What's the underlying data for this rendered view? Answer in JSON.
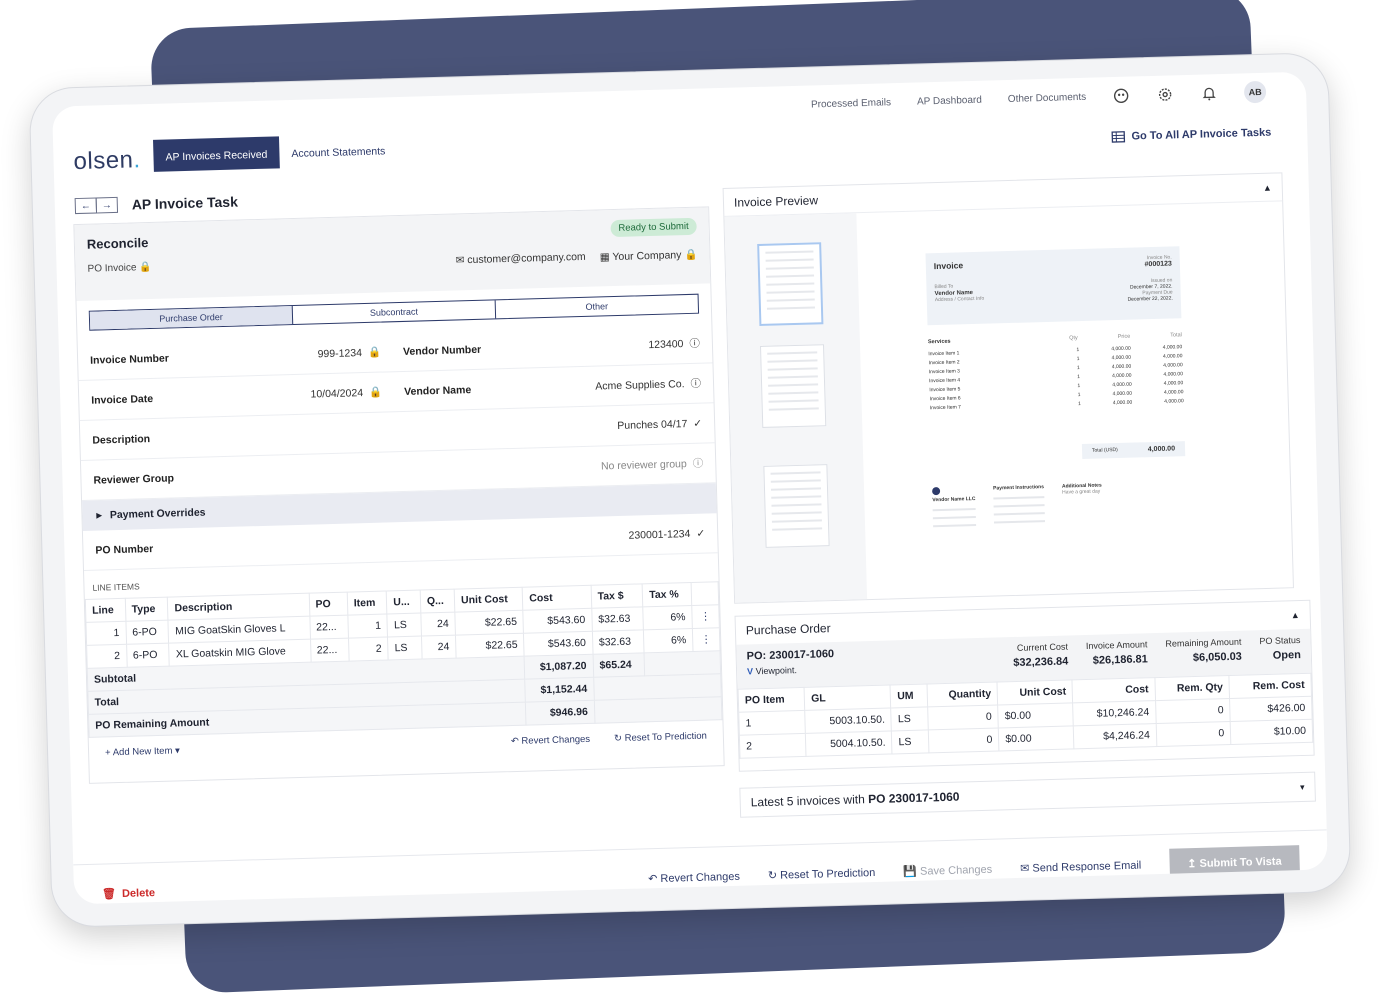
{
  "brand": {
    "logo_main": "olsen",
    "logo_dot": "."
  },
  "top_nav": {
    "items": [
      "Processed Emails",
      "AP Dashboard",
      "Other Documents"
    ],
    "avatar": "AB"
  },
  "main_tabs": [
    {
      "label": "AP Invoices Received"
    },
    {
      "label": "Account Statements"
    }
  ],
  "go_all": "Go To All AP Invoice Tasks",
  "page_title": "AP Invoice Task",
  "reconcile": {
    "title": "Reconcile",
    "subtitle": "PO Invoice",
    "status": "Ready to Submit",
    "email": "customer@company.com",
    "company": "Your Company",
    "segments": [
      "Purchase Order",
      "Subcontract",
      "Other"
    ]
  },
  "fields": {
    "invoice_number_label": "Invoice Number",
    "invoice_number": "999-1234",
    "vendor_number_label": "Vendor Number",
    "vendor_number": "123400",
    "invoice_date_label": "Invoice Date",
    "invoice_date": "10/04/2024",
    "vendor_name_label": "Vendor Name",
    "vendor_name": "Acme Supplies Co.",
    "description_label": "Description",
    "description": "Punches 04/17",
    "reviewer_group_label": "Reviewer Group",
    "reviewer_group": "No reviewer group",
    "payment_overrides": "Payment Overrides",
    "po_number_label": "PO Number",
    "po_number": "230001-1234"
  },
  "line_items": {
    "section_label": "LINE ITEMS",
    "headers": [
      "Line",
      "Type",
      "Description",
      "PO",
      "Item",
      "U...",
      "Q...",
      "Unit Cost",
      "Cost",
      "Tax $",
      "Tax %"
    ],
    "rows": [
      [
        "1",
        "6-PO",
        "MIG GoatSkin Gloves L",
        "22...",
        "1",
        "LS",
        "24",
        "$22.65",
        "$543.60",
        "$32.63",
        "6%"
      ],
      [
        "2",
        "6-PO",
        "XL Goatskin MIG Glove",
        "22...",
        "2",
        "LS",
        "24",
        "$22.65",
        "$543.60",
        "$32.63",
        "6%"
      ]
    ],
    "subtotal_label": "Subtotal",
    "subtotal_cost": "$1,087.20",
    "subtotal_tax": "$65.24",
    "total_label": "Total",
    "total": "$1,152.44",
    "remaining_label": "PO Remaining Amount",
    "remaining": "$946.96",
    "add_new": "Add New Item",
    "revert": "Revert Changes",
    "reset": "Reset To Prediction"
  },
  "preview": {
    "title": "Invoice Preview",
    "doc": {
      "heading": "Invoice",
      "invoice_no_label": "Invoice No.",
      "invoice_no": "#000123",
      "billed_to": "Billed To",
      "vendor": "Vendor Name",
      "address": "Address / Contact Info",
      "issued_label": "Issued on",
      "issued": "December 7, 2022.",
      "due_label": "Payment Due",
      "due": "December 22, 2022.",
      "services": "Services",
      "qty": "Qty",
      "price": "Price",
      "total_col": "Total",
      "items": [
        "Invoice Item 1",
        "Invoice Item 2",
        "Invoice Item 3",
        "Invoice Item 4",
        "Invoice Item 5",
        "Invoice Item 6",
        "Invoice Item 7"
      ],
      "item_qty": "1",
      "item_price": "4,000.00",
      "item_total": "4,000.00",
      "total_label": "Total (USD)",
      "total": "4,000.00",
      "vendor_llc": "Vendor Name LLC",
      "payment_instructions": "Payment Instructions",
      "additional_notes": "Additional Notes",
      "notes_text": "Have a great day"
    }
  },
  "purchase_order": {
    "title": "Purchase Order",
    "po": "PO: 230017-1060",
    "source": "Viewpoint.",
    "stats": [
      {
        "k": "Current Cost",
        "v": "$32,236.84"
      },
      {
        "k": "Invoice Amount",
        "v": "$26,186.81"
      },
      {
        "k": "Remaining Amount",
        "v": "$6,050.03"
      },
      {
        "k": "PO Status",
        "v": "Open"
      }
    ],
    "headers": [
      "PO Item",
      "GL",
      "UM",
      "Quantity",
      "Unit Cost",
      "Cost",
      "Rem. Qty",
      "Rem. Cost"
    ],
    "rows": [
      [
        "1",
        "5003.10.50.",
        "LS",
        "0",
        "$0.00",
        "$10,246.24",
        "0",
        "$426.00"
      ],
      [
        "2",
        "5004.10.50.",
        "LS",
        "0",
        "$0.00",
        "$4,246.24",
        "0",
        "$10.00"
      ]
    ]
  },
  "latest": {
    "label": "Latest 5 invoices with",
    "po": "PO 230017-1060"
  },
  "footer": {
    "delete": "Delete",
    "revert": "Revert Changes",
    "reset": "Reset To Prediction",
    "save": "Save Changes",
    "send": "Send Response Email",
    "submit": "Submit To Vista"
  }
}
